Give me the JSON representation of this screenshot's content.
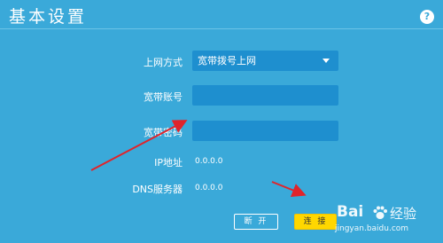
{
  "header": {
    "title": "基本设置",
    "help_label": "?"
  },
  "form": {
    "connection_type": {
      "label": "上网方式",
      "selected": "宽带拨号上网"
    },
    "account": {
      "label": "宽带账号",
      "value": ""
    },
    "password": {
      "label": "宽带密码",
      "value": ""
    },
    "ip": {
      "label": "IP地址",
      "value": "0.0.0.0"
    },
    "dns": {
      "label": "DNS服务器",
      "value": "0.0.0.0"
    }
  },
  "actions": {
    "disconnect_label": "断 开",
    "connect_label": "连 接"
  },
  "watermark": {
    "brand": "Bai",
    "jingyan": "经验",
    "url": "jingyan.baidu.com"
  },
  "colors": {
    "background": "#3aa9d9",
    "field": "#1e8fcf",
    "connect_button": "#ffd700",
    "annotation_arrow": "#e0242b"
  }
}
